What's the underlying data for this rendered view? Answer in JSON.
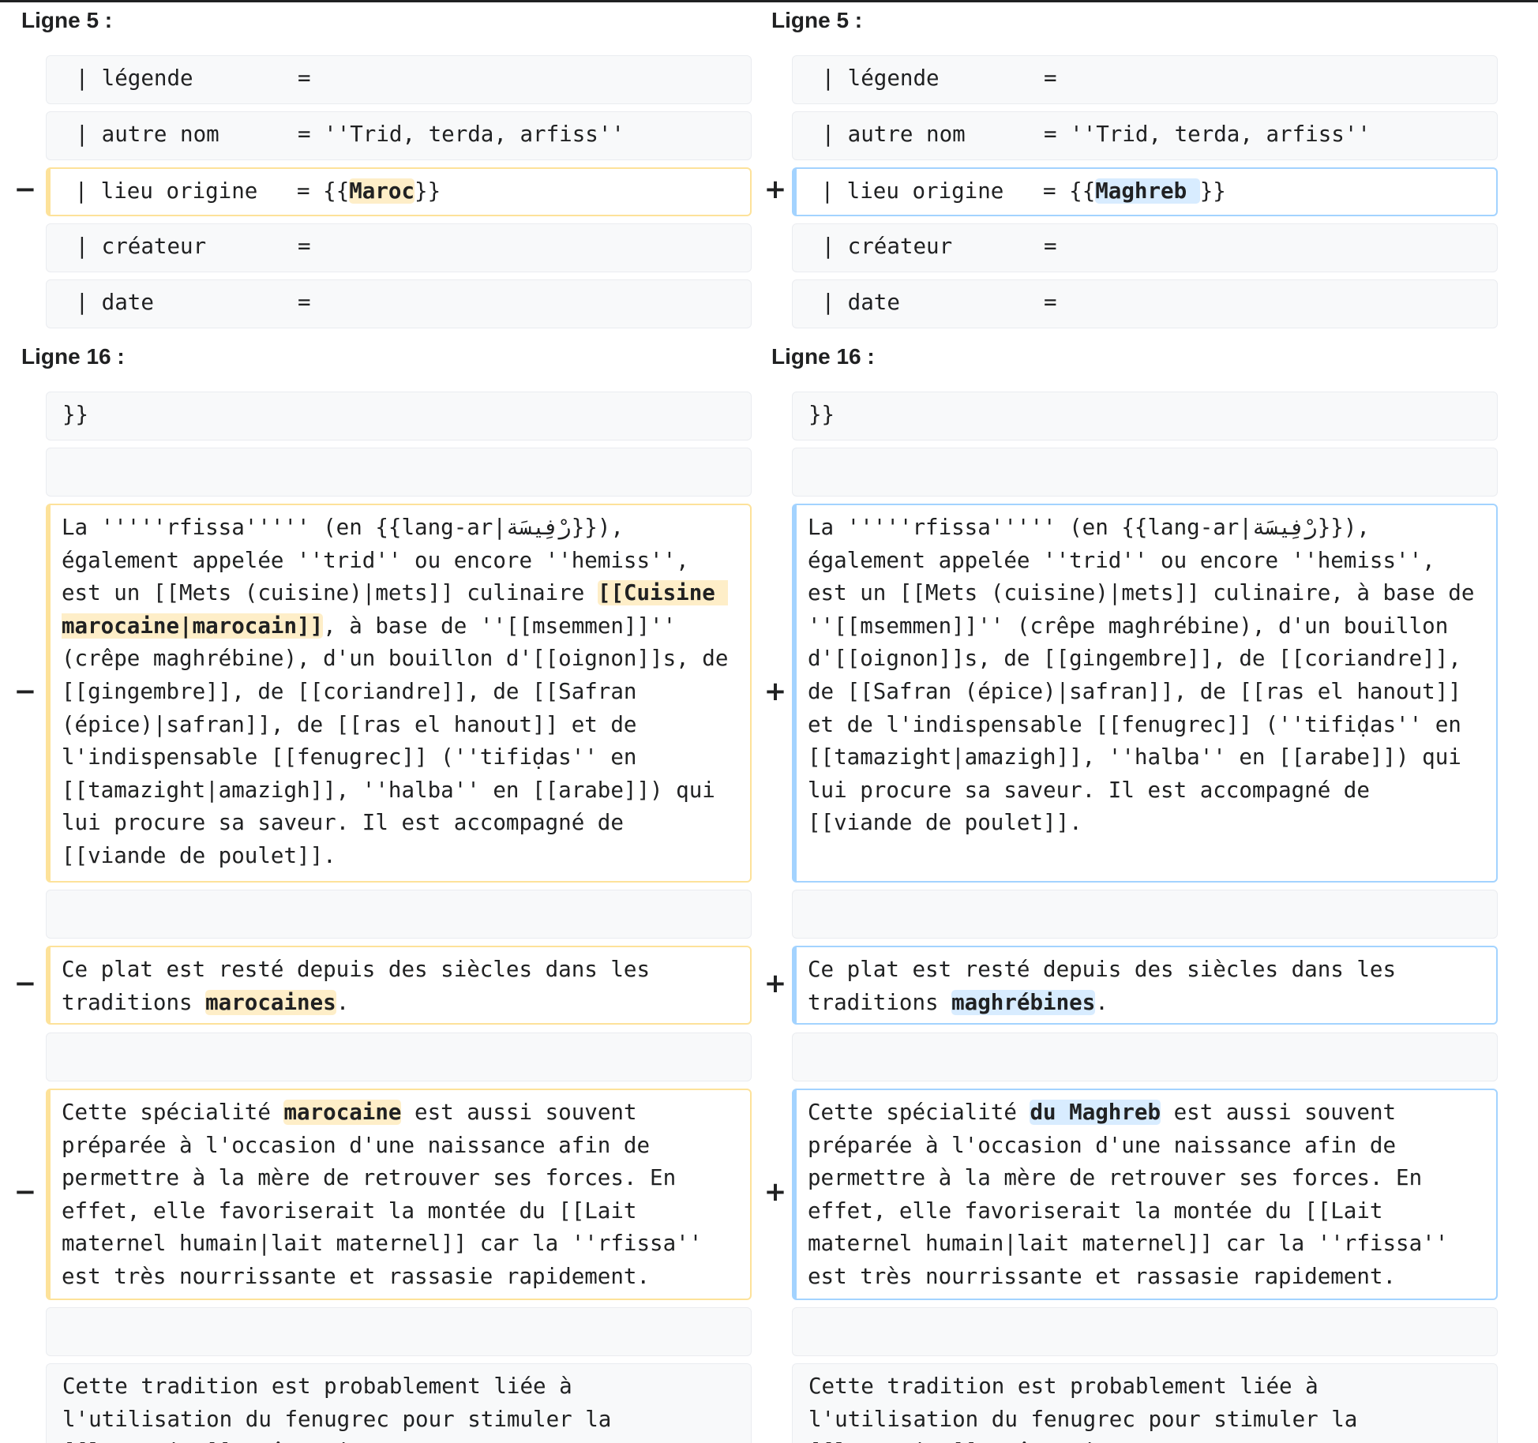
{
  "headers": {
    "line5_left": "Ligne 5 :",
    "line5_right": "Ligne 5 :",
    "line16_left": "Ligne 16 :",
    "line16_right": "Ligne 16 :"
  },
  "markers": {
    "minus": "−",
    "plus": "+"
  },
  "context": {
    "legende": " | légende        =",
    "autre_nom": " | autre nom      = ''Trid, terda, arfiss''",
    "createur": " | créateur       =",
    "date": " | date           =",
    "close_braces": "}}",
    "empty": "",
    "tradition": "Cette tradition est probablement liée à l'utilisation du fenugrec pour stimuler la [[lactation]], même si"
  },
  "lieu": {
    "left_pre": " | lieu origine   = {{",
    "left_hl": "Maroc",
    "left_post": "}}",
    "right_pre": " | lieu origine   = {{",
    "right_hl": "Maghreb ",
    "right_post": "}}"
  },
  "para1": {
    "left_pre": "La '''''rfissa''''' (en {{lang-ar|رْفِيسَة}}), également appelée ''trid'' ou encore ''hemiss'', est un [[Mets (cuisine)|mets]] culinaire ",
    "left_hl": "[[Cuisine marocaine|marocain]]",
    "left_post": ", à base de ''[[msemmen]]'' (crêpe maghrébine), d'un bouillon d'[[oignon]]s, de [[gingembre]], de [[coriandre]], de [[Safran (épice)|safran]], de [[ras el hanout]] et de l'indispensable [[fenugrec]] (''tifiḍas'' en [[tamazight|amazigh]], ''halba'' en [[arabe]]) qui lui procure sa saveur. Il est accompagné de [[viande de poulet]].",
    "right": "La '''''rfissa''''' (en {{lang-ar|رْفِيسَة}}), également appelée ''trid'' ou encore ''hemiss'', est un [[Mets (cuisine)|mets]] culinaire, à base de ''[[msemmen]]'' (crêpe maghrébine), d'un bouillon d'[[oignon]]s, de [[gingembre]], de [[coriandre]], de [[Safran (épice)|safran]], de [[ras el hanout]] et de l'indispensable [[fenugrec]] (''tifiḍas'' en [[tamazight|amazigh]], ''halba'' en [[arabe]]) qui lui procure sa saveur. Il est accompagné de [[viande de poulet]]."
  },
  "para2": {
    "left_pre": "Ce plat est resté depuis des siècles dans les traditions ",
    "left_hl": "marocaines",
    "left_post": ".",
    "right_pre": "Ce plat est resté depuis des siècles dans les traditions ",
    "right_hl": "maghrébines",
    "right_post": "."
  },
  "para3": {
    "left_pre": "Cette spécialité ",
    "left_hl": "marocaine",
    "left_post": " est aussi souvent préparée à l'occasion d'une naissance afin de permettre à la mère de retrouver ses forces. En effet, elle favoriserait la montée du [[Lait maternel humain|lait maternel]] car la ''rfissa'' est très nourrissante et rassasie rapidement.",
    "right_pre": "Cette spécialité ",
    "right_hl": "du Maghreb",
    "right_post": " est aussi souvent préparée à l'occasion d'une naissance afin de permettre à la mère de retrouver ses forces. En effet, elle favoriserait la montée du [[Lait maternel humain|lait maternel]] car la ''rfissa'' est très nourrissante et rassasie rapidement."
  },
  "colors": {
    "deleted_border": "#fde29a",
    "deleted_highlight": "#feeec8",
    "added_border": "#a3d3ff",
    "added_highlight": "#d8ecff",
    "context_background": "#f8f9fa"
  }
}
